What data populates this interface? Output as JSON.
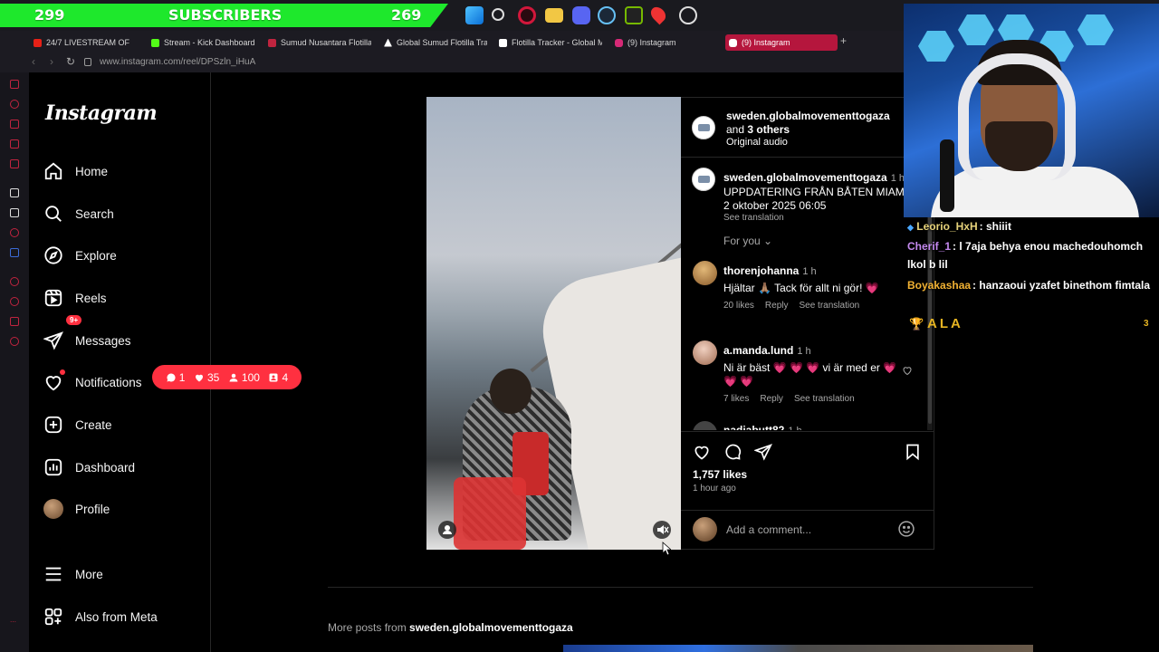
{
  "stream_overlay": {
    "subs_left": "299",
    "subs_title": "SUBSCRIBERS",
    "subs_right": "269",
    "taskbar_icons": [
      "windows-icon",
      "search-icon",
      "opera-icon",
      "folder-icon",
      "discord-icon",
      "steam-icon",
      "nvidia-icon",
      "maps-icon",
      "clock-icon"
    ],
    "accent": "#1ee82c"
  },
  "browser": {
    "tabs": [
      {
        "label": "24/7 LIVESTREAM OF",
        "favicon": "youtube-icon",
        "color": "#e62117"
      },
      {
        "label": "Stream - Kick Dashboard",
        "favicon": "kick-icon",
        "color": "#53fc18"
      },
      {
        "label": "Sumud Nusantara Flotilla",
        "favicon": "flag-icon",
        "color": "#c0243f"
      },
      {
        "label": "Global Sumud Flotilla Tra",
        "favicon": "triangle-icon",
        "color": "#ffffff"
      },
      {
        "label": "Flotilla Tracker - Global M",
        "favicon": "tracker-icon",
        "color": "#ffffff"
      },
      {
        "label": "(9) Instagram",
        "favicon": "instagram-icon",
        "color": "#d62976"
      },
      {
        "label": "(9) Instagram",
        "favicon": "instagram-icon",
        "color": "#d62976",
        "active": true
      }
    ],
    "url": "www.instagram.com/reel/DPSzln_iHuA"
  },
  "instagram": {
    "logo": "Instagram",
    "nav": [
      {
        "label": "Home",
        "icon": "home-icon"
      },
      {
        "label": "Search",
        "icon": "search-icon"
      },
      {
        "label": "Explore",
        "icon": "compass-icon"
      },
      {
        "label": "Reels",
        "icon": "reels-icon"
      },
      {
        "label": "Messages",
        "icon": "send-icon",
        "badge": "9+"
      },
      {
        "label": "Notifications",
        "icon": "heart-icon"
      },
      {
        "label": "Create",
        "icon": "plus-square-icon"
      },
      {
        "label": "Dashboard",
        "icon": "chart-icon"
      },
      {
        "label": "Profile",
        "icon": "avatar"
      }
    ],
    "more": "More",
    "also_from_meta": "Also from Meta",
    "notif_pill": {
      "comments": "1",
      "likes": "35",
      "follows": "100",
      "tags": "4"
    },
    "post": {
      "header_user": "sweden.globalmovementtogaza",
      "header_and": "and ",
      "header_others": "3 others",
      "audio": "Original audio",
      "caption": {
        "user": "sweden.globalmovementtogaza",
        "time": "1 h",
        "text1": "UPPDATERING FRÅN BÅTEN MIAMIA",
        "text2": "2 oktober 2025 06:05",
        "see_translation": "See translation"
      },
      "for_you": "For you",
      "comments": [
        {
          "user": "thorenjohanna",
          "time": "1 h",
          "text": "Hjältar 🙏🏽 Tack för allt ni gör! 💗",
          "likes": "20 likes",
          "reply": "Reply",
          "translate": "See translation"
        },
        {
          "user": "a.manda.lund",
          "time": "1 h",
          "text": "Ni är bäst 💗 💗 💗 vi är med er 💗 💗 💗",
          "likes": "7 likes",
          "reply": "Reply",
          "translate": "See translation"
        },
        {
          "user": "nadiabutt82",
          "time": "1 h"
        }
      ],
      "likes": "1,757 likes",
      "ago": "1 hour ago",
      "comment_placeholder": "Add a comment..."
    },
    "more_posts_prefix": "More posts from ",
    "more_posts_user": "sweden.globalmovementtogaza"
  },
  "stream_chat": [
    {
      "user": "Leorio_HxH",
      "color": "#e6d27a",
      "text": ": shiiit"
    },
    {
      "user": "Cherif_1",
      "color": "#c58af0",
      "text": ": l 7aja behya enou machedouhomch lkol b lil"
    },
    {
      "user": "Boyakashaa",
      "color": "#f2b233",
      "text": ": hanzaoui yzafet binethom fimtala"
    }
  ],
  "chat_alert": {
    "text": "ALA",
    "count": "3",
    "color": "#e6b422"
  }
}
